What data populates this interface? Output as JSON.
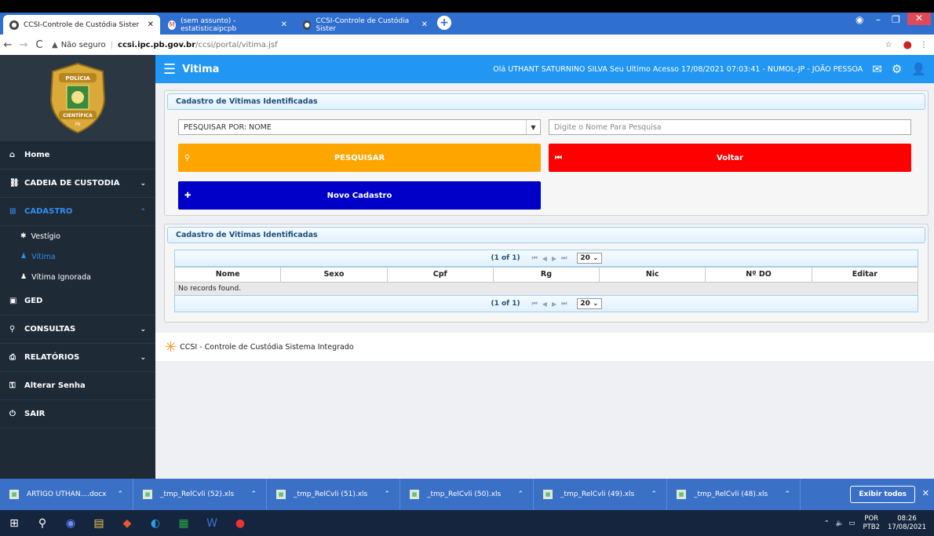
{
  "browser": {
    "tabs": [
      {
        "title": "CCSI-Controle de Custódia Sister",
        "active": true
      },
      {
        "title": "(sem assunto) - estatisticaipcpb",
        "active": false
      },
      {
        "title": "CCSI-Controle de Custódia Sister",
        "active": false
      }
    ],
    "security": "Não seguro",
    "url_domain": "ccsi.ipc.pb.gov.br",
    "url_path": "/ccsi/portal/vitima.jsf"
  },
  "logo": {
    "top_text": "POLÍCIA",
    "bottom_text": "CIENTÍFICA",
    "state": "PB"
  },
  "sidebar": {
    "items": [
      {
        "label": "Home",
        "icon": "home-icon"
      },
      {
        "label": "CADEIA DE CUSTODIA",
        "icon": "chain-icon"
      },
      {
        "label": "CADASTRO",
        "icon": "plus-square-icon"
      },
      {
        "label": "GED",
        "icon": "briefcase-icon"
      },
      {
        "label": "CONSULTAS",
        "icon": "search-icon"
      },
      {
        "label": "RELATÓRIOS",
        "icon": "print-icon"
      },
      {
        "label": "Alterar Senha",
        "icon": "key-icon"
      },
      {
        "label": "SAIR",
        "icon": "power-icon"
      }
    ],
    "sub_items": [
      {
        "label": "Vestígio",
        "icon": "asterisk-icon"
      },
      {
        "label": "Vítima",
        "icon": "user-icon"
      },
      {
        "label": "Vítima Ignorada",
        "icon": "user-icon"
      }
    ]
  },
  "topbar": {
    "title": "Vitima",
    "greeting": "Olá UTHANT SATURNINO SILVA Seu Ultimo Acesso 17/08/2021 07:03:41 - NUMOL-JP - JOÃO PESSOA"
  },
  "search_panel": {
    "title": "Cadastro de Vitimas Identificadas",
    "select_value": "PESQUISAR POR: NOME",
    "input_placeholder": "Digite o Nome Para Pesquisa",
    "search_button": "PESQUISAR",
    "back_button": "Voltar",
    "new_button": "Novo Cadastro",
    "colors": {
      "search": "#ffa500",
      "back": "#ff0000",
      "new": "#0000c8"
    }
  },
  "results_panel": {
    "title": "Cadastro de Vitimas Identificadas",
    "page_info": "(1 of 1)",
    "rows_per_page": "20",
    "columns": [
      "Nome",
      "Sexo",
      "Cpf",
      "Rg",
      "Nic",
      "Nº DO",
      "Editar"
    ],
    "empty_message": "No records found."
  },
  "footer": {
    "text": "CCSI - Controle de Custódia Sistema Integrado"
  },
  "downloads": {
    "files": [
      "ARTIGO UTHAN....docx",
      "_tmp_RelCvli (52).xls",
      "_tmp_RelCvli (51).xls",
      "_tmp_RelCvli (50).xls",
      "_tmp_RelCvli (49).xls",
      "_tmp_RelCvli (48).xls"
    ],
    "show_all": "Exibir todos"
  },
  "taskbar": {
    "lang_top": "POR",
    "lang_bottom": "PTB2",
    "time": "08:26",
    "date": "17/08/2021"
  }
}
